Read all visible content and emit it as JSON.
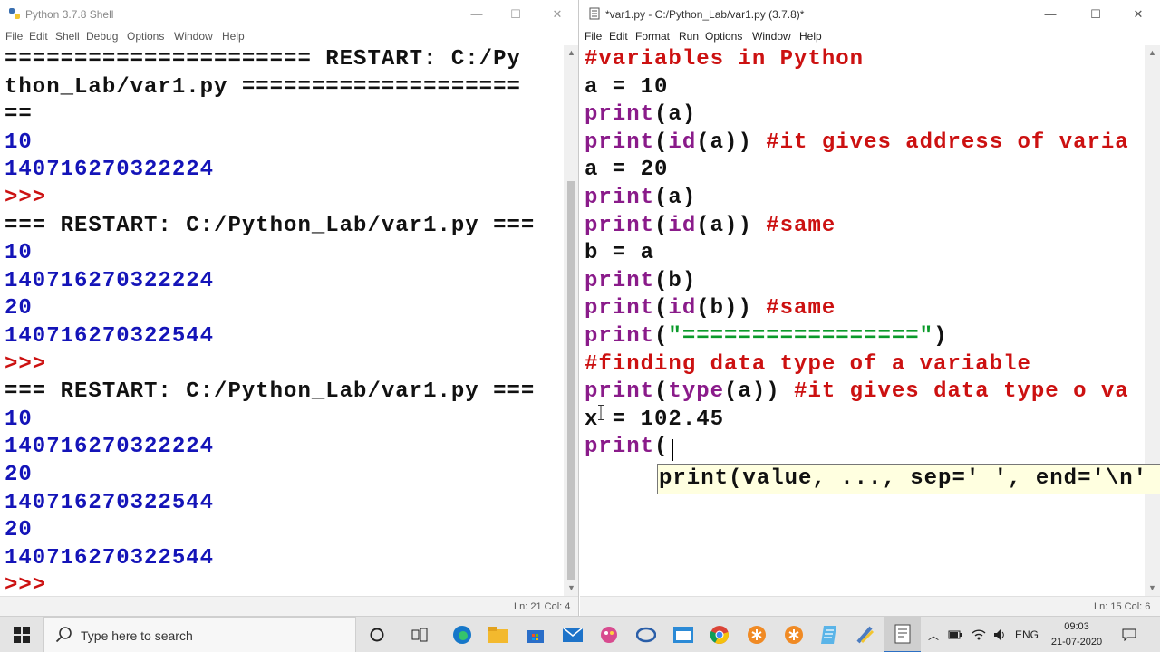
{
  "shell": {
    "title": "Python 3.7.8 Shell",
    "menu": [
      "File",
      "Edit",
      "Shell",
      "Debug",
      "Options",
      "Window",
      "Help"
    ],
    "lines": [
      {
        "text": "====================== RESTART: C:/Py",
        "color": "blk"
      },
      {
        "text": "thon_Lab/var1.py ====================",
        "color": "blk"
      },
      {
        "text": "==",
        "color": "blk"
      },
      {
        "text": "10",
        "color": "blue"
      },
      {
        "text": "140716270322224",
        "color": "blue"
      },
      {
        "text": ">>>",
        "color": "red"
      },
      {
        "text": "=== RESTART: C:/Python_Lab/var1.py ===",
        "color": "blk"
      },
      {
        "text": "10",
        "color": "blue"
      },
      {
        "text": "140716270322224",
        "color": "blue"
      },
      {
        "text": "20",
        "color": "blue"
      },
      {
        "text": "140716270322544",
        "color": "blue"
      },
      {
        "text": ">>>",
        "color": "red"
      },
      {
        "text": "=== RESTART: C:/Python_Lab/var1.py ===",
        "color": "blk"
      },
      {
        "text": "10",
        "color": "blue"
      },
      {
        "text": "140716270322224",
        "color": "blue"
      },
      {
        "text": "20",
        "color": "blue"
      },
      {
        "text": "140716270322544",
        "color": "blue"
      },
      {
        "text": "20",
        "color": "blue"
      },
      {
        "text": "140716270322544",
        "color": "blue"
      },
      {
        "text": ">>>",
        "color": "red"
      }
    ],
    "status": "Ln: 21  Col: 4"
  },
  "editor": {
    "title": "*var1.py - C:/Python_Lab/var1.py (3.7.8)*",
    "menu": [
      "File",
      "Edit",
      "Format",
      "Run",
      "Options",
      "Window",
      "Help"
    ],
    "lines": [
      [
        {
          "t": "#variables in Python",
          "c": "red"
        }
      ],
      [
        {
          "t": "a = 10",
          "c": "blk"
        }
      ],
      [
        {
          "t": "print",
          "c": "purple"
        },
        {
          "t": "(a)",
          "c": "blk"
        }
      ],
      [
        {
          "t": "print",
          "c": "purple"
        },
        {
          "t": "(",
          "c": "blk"
        },
        {
          "t": "id",
          "c": "purple"
        },
        {
          "t": "(a)) ",
          "c": "blk"
        },
        {
          "t": "#it gives address of varia",
          "c": "red"
        }
      ],
      [
        {
          "t": "a = 20",
          "c": "blk"
        }
      ],
      [
        {
          "t": "print",
          "c": "purple"
        },
        {
          "t": "(a)",
          "c": "blk"
        }
      ],
      [
        {
          "t": "print",
          "c": "purple"
        },
        {
          "t": "(",
          "c": "blk"
        },
        {
          "t": "id",
          "c": "purple"
        },
        {
          "t": "(a)) ",
          "c": "blk"
        },
        {
          "t": "#same",
          "c": "red"
        }
      ],
      [
        {
          "t": "b = a",
          "c": "blk"
        }
      ],
      [
        {
          "t": "print",
          "c": "purple"
        },
        {
          "t": "(b)",
          "c": "blk"
        }
      ],
      [
        {
          "t": "print",
          "c": "purple"
        },
        {
          "t": "(",
          "c": "blk"
        },
        {
          "t": "id",
          "c": "purple"
        },
        {
          "t": "(b)) ",
          "c": "blk"
        },
        {
          "t": "#same",
          "c": "red"
        }
      ],
      [
        {
          "t": "print",
          "c": "purple"
        },
        {
          "t": "(",
          "c": "blk"
        },
        {
          "t": "\"=================\"",
          "c": "green"
        },
        {
          "t": ")",
          "c": "blk"
        }
      ],
      [
        {
          "t": "#finding data type of a variable",
          "c": "red"
        }
      ],
      [
        {
          "t": "print",
          "c": "purple"
        },
        {
          "t": "(",
          "c": "blk"
        },
        {
          "t": "type",
          "c": "purple"
        },
        {
          "t": "(a)) ",
          "c": "blk"
        },
        {
          "t": "#it gives data type o va",
          "c": "red"
        }
      ],
      [
        {
          "t": "x = 102.45",
          "c": "blk"
        }
      ],
      [
        {
          "t": "print",
          "c": "purple"
        },
        {
          "t": "(",
          "c": "blk"
        }
      ]
    ],
    "calltip": "print(value, ..., sep=' ', end='\\n'",
    "status": "Ln: 15  Col: 6"
  },
  "taskbar": {
    "search_placeholder": "Type here to search",
    "language": "ENG",
    "time": "09:03",
    "date": "21-07-2020"
  }
}
